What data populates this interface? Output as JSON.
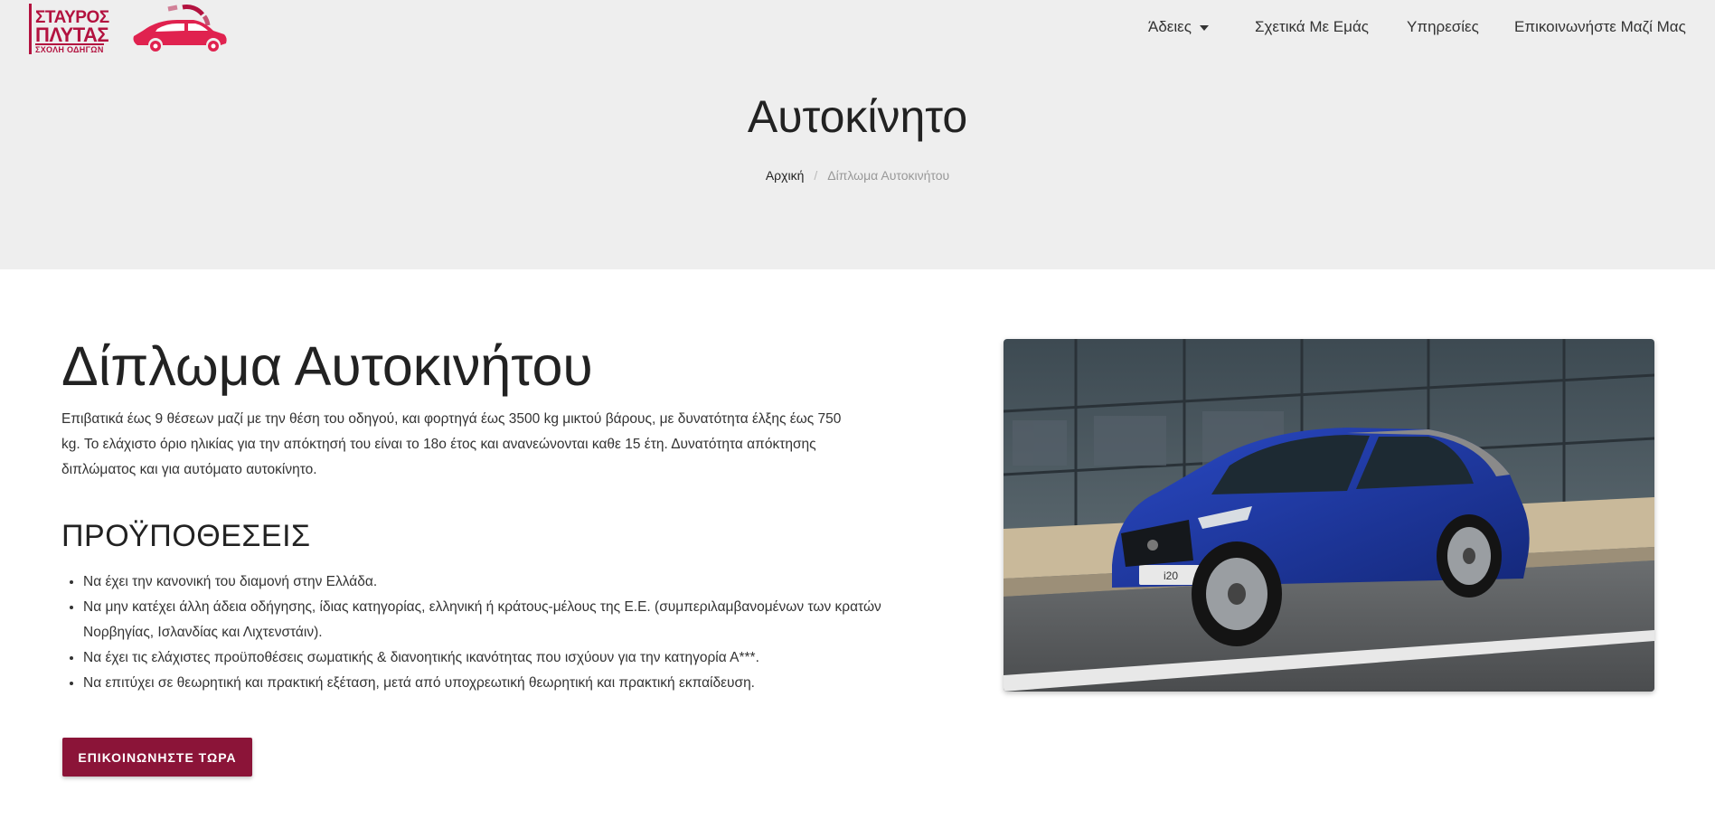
{
  "logo": {
    "line1": "ΣΤΑΥΡΟΣ",
    "line2": "ΠΛΥΤΑΣ",
    "line3": "ΣΧΟΛΗ ΟΔΗΓΩΝ",
    "brand_color": "#b3123f"
  },
  "nav": {
    "items": [
      {
        "label": "Άδειες",
        "has_dropdown": true,
        "icon": "caret-down-icon"
      },
      {
        "label": "Σχετικά Με Εμάς"
      },
      {
        "label": "Υπηρεσίες"
      },
      {
        "label": "Επικοινωνήστε Μαζί Μας"
      }
    ]
  },
  "hero": {
    "title": "Αυτοκίνητο",
    "breadcrumb": {
      "home": "Αρχική",
      "separator": "/",
      "current": "Δίπλωμα Αυτοκινήτου"
    }
  },
  "main": {
    "title": "Δίπλωμα Αυτοκινήτου",
    "intro": "Επιβατικά έως 9 θέσεων μαζί με την θέση του οδηγού, και φορτηγά έως 3500 kg μικτού βάρους, με δυνατότητα έλξης έως 750 kg. Το ελάχιστο όριο ηλικίας για την απόκτησή του είναι το 18ο έτος και ανανεώνονται καθε 15 έτη. Δυνατότητα απόκτησης διπλώματος και για αυτόματο αυτοκίνητο.",
    "requirements_title": "ΠΡΟΫΠΟΘΕΣΕΙΣ",
    "requirements": [
      "Να έχει την κανονική του διαμονή στην Ελλάδα.",
      "Να μην κατέχει άλλη άδεια οδήγησης, ίδιας κατηγορίας, ελληνική ή κράτους-μέλους της Ε.Ε. (συμπεριλαμβανομένων των κρατών Νορβηγίας, Ισλανδίας και Λιχτενστάιν).",
      "Να έχει τις ελάχιστες προϋποθέσεις σωματικής & διανοητικής ικανότητας που ισχύουν για την κατηγορία Α***.",
      "Να επιτύχει σε θεωρητική και πρακτική εξέταση, μετά από υποχρεωτική θεωρητική και πρακτική εκπαίδευση."
    ],
    "cta_label": "ΕΠΙΚΟΙΝΩΝΗΣΤΕ ΤΩΡΑ",
    "cta_color": "#8b1438"
  },
  "car_image": {
    "plate_text": "i20",
    "car_color": "#1f3a9e"
  }
}
